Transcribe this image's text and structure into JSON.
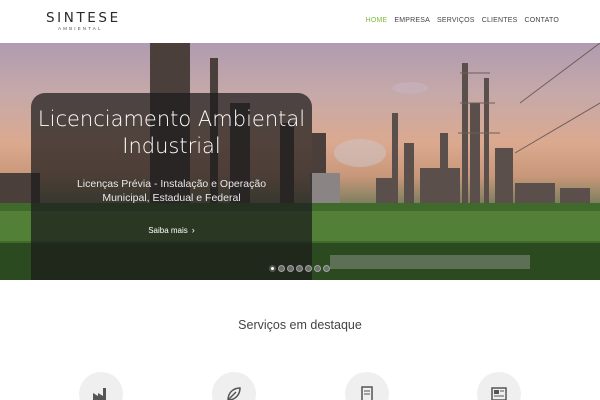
{
  "brand": {
    "name": "SINTESE",
    "tagline": "AMBIENTAL"
  },
  "nav": {
    "items": [
      {
        "label": "HOME",
        "active": true
      },
      {
        "label": "EMPRESA",
        "active": false
      },
      {
        "label": "SERVIÇOS",
        "active": false
      },
      {
        "label": "CLIENTES",
        "active": false
      },
      {
        "label": "CONTATO",
        "active": false
      }
    ]
  },
  "hero": {
    "title_line1": "Licenciamento Ambiental",
    "title_line2": "Industrial",
    "subtitle_line1": "Licenças Prévia - Instalação e Operação",
    "subtitle_line2": "Municipal, Estadual e Federal",
    "button_label": "Saiba mais",
    "slide_count": 7,
    "active_slide": 1
  },
  "services": {
    "title": "Serviços em destaque",
    "icons": [
      "factory-icon",
      "leaf-icon",
      "document-icon",
      "newspaper-icon"
    ]
  },
  "colors": {
    "accent": "#7fba3a",
    "caption_bg": "#1c1c1c"
  }
}
